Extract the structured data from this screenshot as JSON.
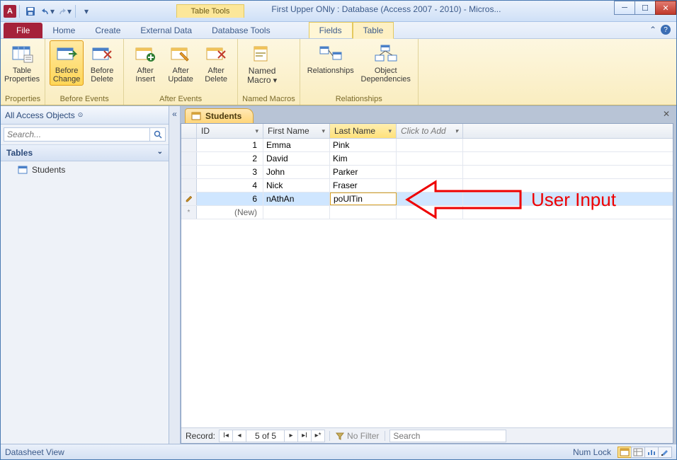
{
  "titlebar": {
    "tool_tab": "Table Tools",
    "window_title": "First Upper ONly : Database (Access 2007 - 2010)  -  Micros..."
  },
  "tabs": {
    "file": "File",
    "home": "Home",
    "create": "Create",
    "external": "External Data",
    "dbtools": "Database Tools",
    "fields": "Fields",
    "table": "Table"
  },
  "ribbon": {
    "properties": {
      "table_properties": "Table\nProperties",
      "group": "Properties"
    },
    "before": {
      "change": "Before\nChange",
      "delete": "Before\nDelete",
      "group": "Before Events"
    },
    "after": {
      "insert": "After\nInsert",
      "update": "After\nUpdate",
      "delete": "After\nDelete",
      "group": "After Events"
    },
    "named": {
      "macro": "Named\nMacro",
      "group": "Named Macros"
    },
    "rel": {
      "relationships": "Relationships",
      "deps": "Object\nDependencies",
      "group": "Relationships"
    }
  },
  "nav": {
    "header": "All Access Objects",
    "search_placeholder": "Search...",
    "tables": "Tables",
    "students": "Students"
  },
  "doc": {
    "tab": "Students"
  },
  "grid": {
    "columns": {
      "id": "ID",
      "first": "First Name",
      "last": "Last Name",
      "add": "Click to Add"
    },
    "rows": [
      {
        "id": "1",
        "first": "Emma",
        "last": "Pink"
      },
      {
        "id": "2",
        "first": "David",
        "last": "Kim"
      },
      {
        "id": "3",
        "first": "John",
        "last": "Parker"
      },
      {
        "id": "4",
        "first": "Nick",
        "last": "Fraser"
      },
      {
        "id": "6",
        "first": "nAthAn",
        "last": "poUlTin"
      }
    ],
    "new_row": "(New)"
  },
  "recnav": {
    "label": "Record:",
    "position": "5 of 5",
    "filter": "No Filter",
    "search_placeholder": "Search"
  },
  "status": {
    "view": "Datasheet View",
    "numlock": "Num Lock"
  },
  "annotation": "User Input"
}
